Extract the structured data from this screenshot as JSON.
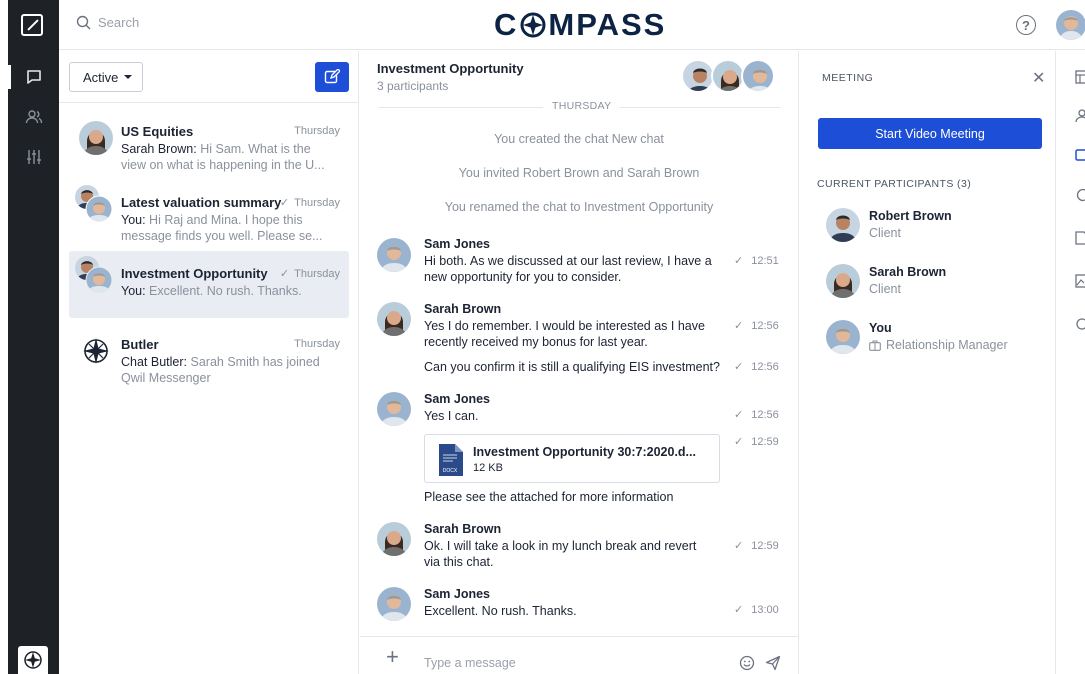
{
  "app": {
    "brand_before": "C",
    "brand_after": "MPASS"
  },
  "search": {
    "placeholder": "Search"
  },
  "chat_list": {
    "filter_label": "Active",
    "items": [
      {
        "title": "US Equities",
        "time": "Thursday",
        "sender": "Sarah Brown:",
        "preview": " Hi Sam. What is the view on what is happening in the U..."
      },
      {
        "title": "Latest valuation summary",
        "time": "Thursday",
        "sender": "You:",
        "preview": " Hi Raj and Mina. I hope this message finds you well. Please se..."
      },
      {
        "title": "Investment Opportunity",
        "time": "Thursday",
        "sender": "You:",
        "preview": " Excellent. No rush. Thanks."
      },
      {
        "title": "Butler",
        "time": "Thursday",
        "sender": "Chat Butler:",
        "preview": " Sarah Smith has joined Qwil Messenger"
      }
    ]
  },
  "chat": {
    "title": "Investment Opportunity",
    "subtitle": "3 participants",
    "day_label": "THURSDAY",
    "system_messages": [
      "You created the chat New chat",
      "You invited Robert Brown and Sarah Brown",
      "You renamed the chat to Investment Opportunity"
    ],
    "messages": [
      {
        "name": "Sam Jones",
        "text": "Hi both. As we discussed at our last review, I have a new opportunity for you to consider.",
        "time": "12:51"
      },
      {
        "name": "Sarah Brown",
        "text": "Yes I do remember. I would be interested as I have recently received my bonus for last year.",
        "time": "12:56"
      },
      {
        "text": "Can you confirm it is still a qualifying EIS investment?",
        "time": "12:56"
      },
      {
        "name": "Sam Jones",
        "text": "Yes I can.",
        "time": "12:56"
      },
      {
        "text": "Please see the attached for more information",
        "time": "12:59"
      },
      {
        "name": "Sarah Brown",
        "text": "Ok. I will take a look in my lunch break and revert via this chat.",
        "time": "12:59"
      },
      {
        "name": "Sam Jones",
        "text": "Excellent. No rush. Thanks.",
        "time": "13:00"
      }
    ],
    "file": {
      "name": "Investment Opportunity 30:7:2020.d...",
      "size": "12 KB",
      "icon_text": "DOCX"
    },
    "composer_placeholder": "Type a message"
  },
  "meeting": {
    "title": "MEETING",
    "start_button": "Start Video Meeting",
    "participants_title": "CURRENT PARTICIPANTS (3)",
    "participants": [
      {
        "name": "Robert Brown",
        "role": "Client"
      },
      {
        "name": "Sarah Brown",
        "role": "Client"
      },
      {
        "name": "You",
        "role": "Relationship Manager"
      }
    ]
  },
  "colors": {
    "accent": "#1d4ed8",
    "rail": "#1e2226",
    "brand": "#0d2344",
    "selected_row": "#e9ecf3"
  }
}
